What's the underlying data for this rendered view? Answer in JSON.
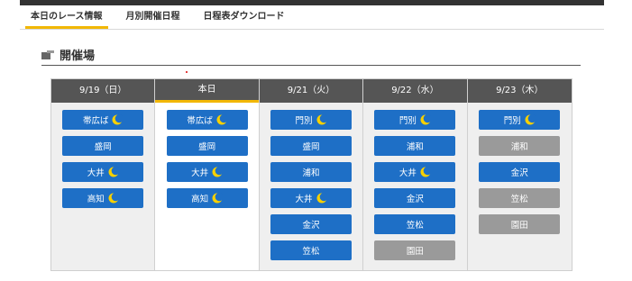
{
  "tabs": [
    {
      "label": "本日のレース情報",
      "active": true
    },
    {
      "label": "月別開催日程",
      "active": false
    },
    {
      "label": "日程表ダウンロード",
      "active": false
    }
  ],
  "section": {
    "title": "開催場"
  },
  "colors": {
    "accent": "#f2b705",
    "race_active": "#1e6fc6",
    "race_inactive": "#9a9a9a",
    "header": "#555555"
  },
  "days": [
    {
      "label": "9/19（日）",
      "today": false,
      "races": [
        {
          "name": "帯広ば",
          "night": true,
          "active": true
        },
        {
          "name": "盛岡",
          "night": false,
          "active": true
        },
        {
          "name": "大井",
          "night": true,
          "active": true
        },
        {
          "name": "高知",
          "night": true,
          "active": true
        }
      ]
    },
    {
      "label": "本日",
      "today": true,
      "races": [
        {
          "name": "帯広ば",
          "night": true,
          "active": true
        },
        {
          "name": "盛岡",
          "night": false,
          "active": true
        },
        {
          "name": "大井",
          "night": true,
          "active": true
        },
        {
          "name": "高知",
          "night": true,
          "active": true
        }
      ]
    },
    {
      "label": "9/21（火）",
      "today": false,
      "races": [
        {
          "name": "門別",
          "night": true,
          "active": true
        },
        {
          "name": "盛岡",
          "night": false,
          "active": true
        },
        {
          "name": "浦和",
          "night": false,
          "active": true
        },
        {
          "name": "大井",
          "night": true,
          "active": true
        },
        {
          "name": "金沢",
          "night": false,
          "active": true
        },
        {
          "name": "笠松",
          "night": false,
          "active": true
        }
      ]
    },
    {
      "label": "9/22（水）",
      "today": false,
      "races": [
        {
          "name": "門別",
          "night": true,
          "active": true
        },
        {
          "name": "浦和",
          "night": false,
          "active": true
        },
        {
          "name": "大井",
          "night": true,
          "active": true
        },
        {
          "name": "金沢",
          "night": false,
          "active": true
        },
        {
          "name": "笠松",
          "night": false,
          "active": true
        },
        {
          "name": "園田",
          "night": false,
          "active": false
        }
      ]
    },
    {
      "label": "9/23（木）",
      "today": false,
      "races": [
        {
          "name": "門別",
          "night": true,
          "active": true
        },
        {
          "name": "浦和",
          "night": false,
          "active": false
        },
        {
          "name": "金沢",
          "night": false,
          "active": true
        },
        {
          "name": "笠松",
          "night": false,
          "active": false
        },
        {
          "name": "園田",
          "night": false,
          "active": false
        }
      ]
    }
  ]
}
